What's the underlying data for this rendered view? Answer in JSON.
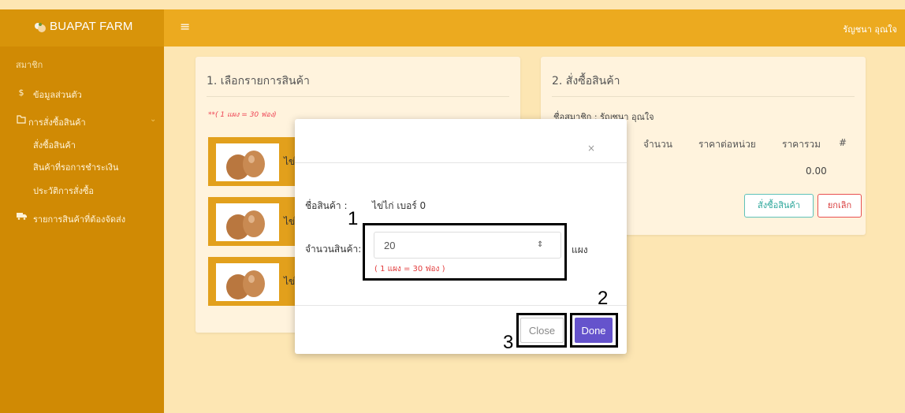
{
  "navbar": {
    "brand": "BUAPAT FARM",
    "menu_icon": "hamburger-icon",
    "user_name": "รัญชนา อุณใจ"
  },
  "sidebar": {
    "header": "สมาชิก",
    "items": [
      {
        "icon": "dollar-icon",
        "label": "ข้อมูลส่วนตัว"
      },
      {
        "icon": "folder-open-icon",
        "label": "การสั่งซื้อสินค้า"
      },
      {
        "icon": "truck-icon",
        "label": "รายการสินค้าที่ต้องจัดส่ง"
      }
    ],
    "subitems": [
      "สั่งซื้อสินค้า",
      "สินค้าที่รอการชำระเงิน",
      "ประวัติการสั่งซื้อ"
    ]
  },
  "card1": {
    "title": "1. เลือกรายการสินค้า",
    "note": "**( 1 แผง = 30 ฟอง)",
    "products": [
      "ไข่ไก่",
      "ไข่ไก่",
      "ไข่ไก่"
    ]
  },
  "card2": {
    "title": "2. สั่งซื้อสินค้า",
    "member": "ชื่อสมาชิก : รัญชนา อุณใจ",
    "headers": [
      "จำนวน",
      "ราคาต่อหน่วย",
      "ราคารวม",
      "#"
    ],
    "total": "0.00",
    "order_btn": "สั่งซื้อสินค้า",
    "cancel_btn": "ยกเลิก"
  },
  "modal": {
    "close_symbol": "×",
    "product_label": "ชื่อสินค้า :",
    "product_value": "ไข่ไก่ เบอร์ 0",
    "qty_label": "จำนวนสินค้า:",
    "qty_value": "20",
    "qty_unit": "แผง",
    "qty_note": "( 1 แผง = 30 ฟอง )",
    "close_btn": "Close",
    "done_btn": "Done"
  },
  "annotations": [
    "1",
    "2",
    "3"
  ]
}
